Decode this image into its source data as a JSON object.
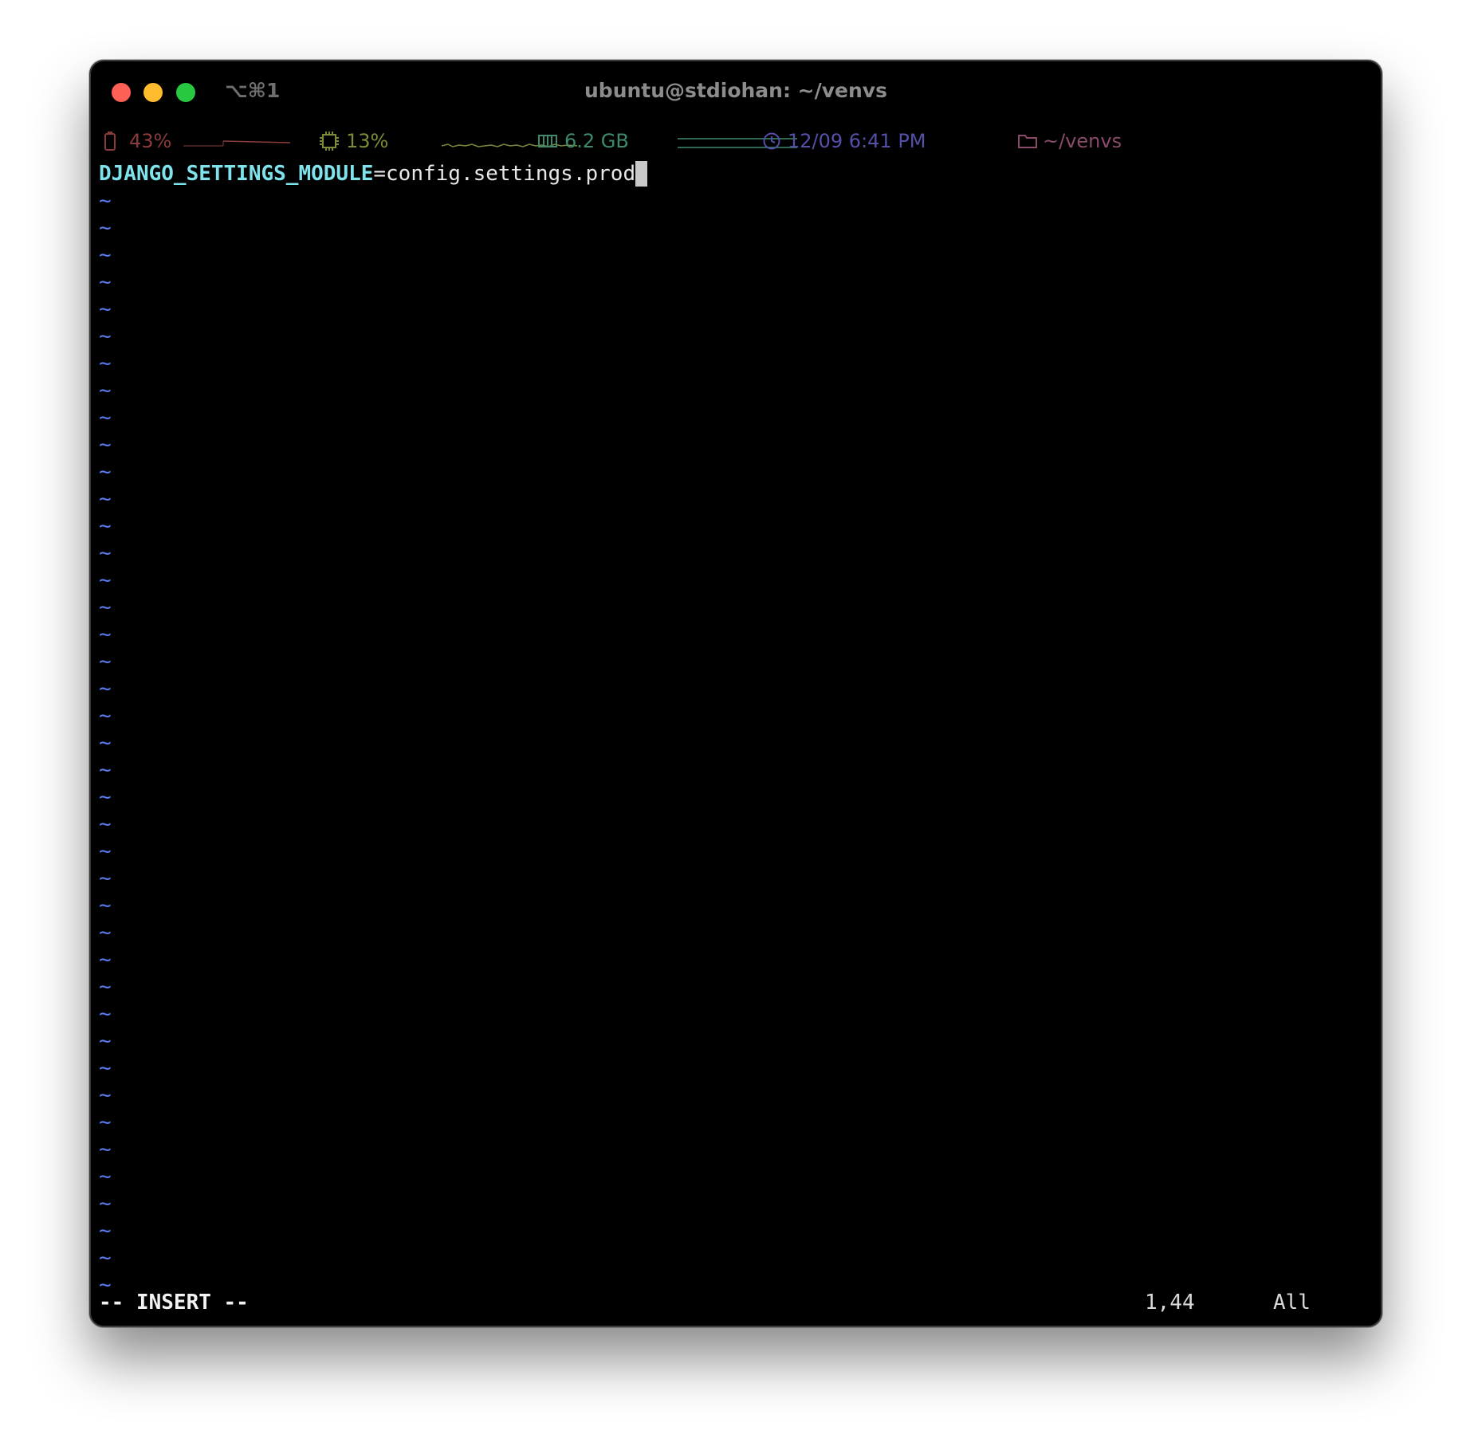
{
  "window": {
    "shortcut": "⌥⌘1",
    "title": "ubuntu@stdiohan: ~/venvs"
  },
  "status_bar": {
    "battery": {
      "icon": "battery-icon",
      "value": "43%",
      "color": "#8a3b3b"
    },
    "cpu": {
      "icon": "cpu-icon",
      "value": "13%",
      "color": "#7a8c3a"
    },
    "memory": {
      "icon": "memory-icon",
      "value": "6.2 GB",
      "color": "#3f8a6a"
    },
    "clock": {
      "icon": "clock-icon",
      "value": "12/09 6:41 PM",
      "color": "#5450a8"
    },
    "folder": {
      "icon": "folder-icon",
      "value": "~/venvs",
      "color": "#8a4a6a"
    }
  },
  "editor": {
    "line1_var": "DJANGO_SETTINGS_MODULE",
    "line1_rest": "=config.settings.prod",
    "empty_line_marker": "~",
    "empty_line_count": 41
  },
  "vim_status": {
    "mode": "-- INSERT --",
    "position": "1,44",
    "scroll": "All"
  }
}
